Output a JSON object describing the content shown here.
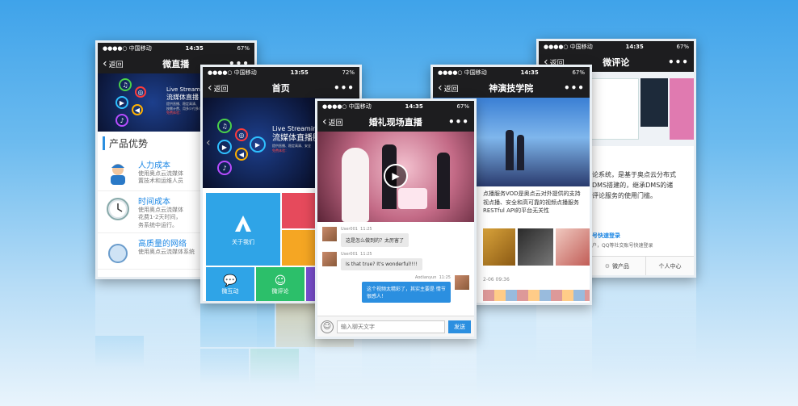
{
  "status": {
    "carrier": "●●●●○ 中国移动",
    "wifi": "",
    "battery_67": "67%",
    "battery_72": "72%",
    "time_1435": "14:35",
    "time_1355": "13:55"
  },
  "nav": {
    "back": "返回",
    "more": "•••"
  },
  "phone_live": {
    "title": "微直播",
    "banner_line1": "Live Streaming",
    "banner_line2": "流媒体直播",
    "banner_small1": "提供直播、稳定高清、",
    "banner_small2": "按需计费、用多少付多少",
    "banner_red": "免费体验：",
    "section_title": "产品优势",
    "rows": [
      {
        "heading": "人力成本",
        "desc1": "使用奥点云流媒体",
        "desc2": "置技术和运维人员"
      },
      {
        "heading": "时间成本",
        "desc1": "使用奥点云流媒体",
        "desc2": "花费1-2天时间，",
        "desc3": "务系统中运行。"
      },
      {
        "heading": "高质量的网络",
        "desc1": "使用奥点云流媒体系统"
      }
    ]
  },
  "phone_home": {
    "title": "首页",
    "banner_line1": "Live Streaming S",
    "banner_line2": "流媒体直播服",
    "banner_small1": "提供直播、稳定高清、安全",
    "banner_red": "免费体验：",
    "tile_about": "关于我们",
    "tile_interact": "微互动",
    "tile_comment": "微评论"
  },
  "phone_wedding": {
    "title": "婚礼现场直播",
    "messages": [
      {
        "user": "User001",
        "time": "11:25",
        "text": "这是怎么做到的？太厉害了"
      },
      {
        "user": "User001",
        "time": "11:25",
        "text": "Is that true? It's wonderful!!!!"
      },
      {
        "user": "Aodianyun",
        "time": "11:25",
        "text": "这个视频太精彩了，其实主要是 情节很感人！"
      }
    ],
    "input_placeholder": "输入聊天文字",
    "send": "发送"
  },
  "phone_academy": {
    "title": "神演技学院",
    "text1": "点播服务VOD是奥点云对外提供的支持",
    "text2": "视点播、安全和高可靠的视频点播服务",
    "text3": "RESTful API的平台无关性",
    "date": "2-06 09:36"
  },
  "phone_comment": {
    "title": "微评论",
    "text1": "论系统，是基于奥点云分布式",
    "text2": "DMS搭建的，继承DMS的诸",
    "text3": "评论服务的使用门槛。",
    "link": "号快速登录",
    "text4": "户，QQ等社交账号快速登录",
    "tab_products": "微产品",
    "tab_center": "个人中心"
  },
  "colors": {
    "accent": "#2b8fe0",
    "tile_blue": "#2fa4e7",
    "tile_red": "#e64a5c",
    "tile_orange": "#f5a623",
    "tile_green": "#2cbf6a",
    "tile_purple": "#7b4fd1"
  }
}
